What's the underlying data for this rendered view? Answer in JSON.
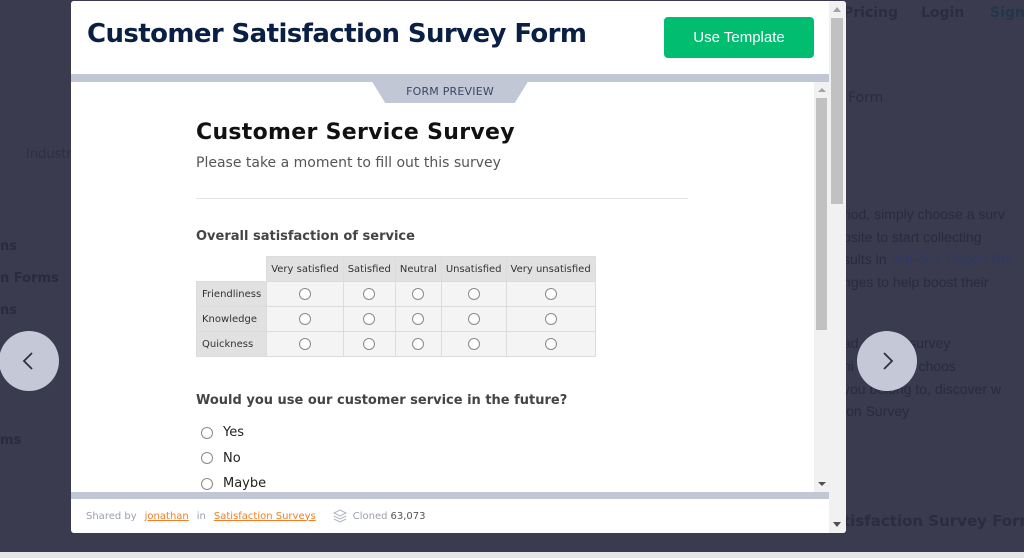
{
  "background": {
    "nav": {
      "pricing": "Pricing",
      "login": "Login",
      "signup": "Sign"
    },
    "form_word": "Form",
    "industry": "Industr",
    "left_items": [
      "ns",
      "n Forms",
      "ns",
      "ms"
    ],
    "paragraph_1": {
      "line_1": "riod, simply choose a surv",
      "line_2": "bsite to start collecting",
      "line_3_prefix": "sults in ",
      "line_3_link": "JotForm Report Bui",
      "line_4": "nges to help boost their"
    },
    "paragraph_2": {
      "line_1": "ad       update survey",
      "line_2": "ni        can even choos",
      "line_3": "  you belong to, discover w",
      "line_4": "ion Survey"
    },
    "bottom_title": "tisfaction Survey Form"
  },
  "carousel": {
    "prev_icon": "chevron-left-icon",
    "next_icon": "chevron-right-icon"
  },
  "modal": {
    "title": "Customer Satisfaction Survey Form",
    "use_template_label": "Use Template",
    "brand_color": "#01bd6f",
    "preview_tab_label": "FORM PREVIEW",
    "form": {
      "title": "Customer Service Survey",
      "subtitle": "Please take a moment to fill out this survey",
      "question_1": {
        "label": "Overall satisfaction of service",
        "columns": [
          "Very satisfied",
          "Satisfied",
          "Neutral",
          "Unsatisfied",
          "Very unsatisfied"
        ],
        "rows": [
          "Friendliness",
          "Knowledge",
          "Quickness"
        ]
      },
      "question_2": {
        "label": "Would you use our customer service in the future?",
        "options": [
          "Yes",
          "No",
          "Maybe"
        ]
      }
    },
    "footer": {
      "shared_by_prefix": "Shared by",
      "author": "jonathan",
      "in_word": "in",
      "category": "Satisfaction Surveys",
      "cloned_label": "Cloned",
      "cloned_count": "63,073",
      "link_color": "#f57d26"
    }
  }
}
